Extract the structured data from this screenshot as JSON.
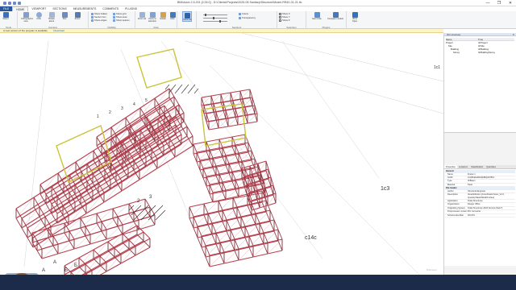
{
  "window": {
    "title": "BIMvision 2.6.201 [2.26.0] - D:\\Clients\\Projects\\2025-05 Sanitary\\Structure\\Model-RR42-01-21.ifc",
    "controls": [
      "—",
      "❐",
      "✕"
    ]
  },
  "tabs": [
    "FILE",
    "HOME",
    "VIEWPORT",
    "SECTIONS",
    "MEASUREMENTS",
    "COMMENTS",
    "PLUGINS"
  ],
  "active_tab": "HOME",
  "ribbon": {
    "groups": [
      "Tools",
      "Camera",
      "Visibility",
      "View",
      "Sections",
      "Selection",
      "Plugins"
    ],
    "buttons": [
      "Select",
      "Orthographic view",
      "Orbit",
      "Rotate about",
      "Pan",
      "Zoom",
      "Zoom all",
      "Zoom to selection",
      "Isolate",
      "Hide",
      "Show all",
      "Colors",
      "Transparency",
      "Nav Cube",
      "Compare models",
      "IFC4 Open"
    ],
    "small_items": [
      "Show hidden",
      "Section box",
      "Show edges",
      "Show grid",
      "Show axes",
      "Show spaces"
    ],
    "checks": [
      "Show X",
      "Show Y",
      "Show Z"
    ]
  },
  "notification": {
    "text": "A new version of the program is available.",
    "link": "Download"
  },
  "viewport": {
    "labels": [
      "1c3",
      "c14c",
      "1c1",
      "А",
      "Б",
      "А",
      "Б",
      "2",
      "3",
      "1",
      "2",
      "3",
      "4",
      "5"
    ],
    "watermark": "BIMvision"
  },
  "structure_panel": {
    "title": "IFC structure",
    "columns": [
      "Name",
      "Type"
    ],
    "rows": [
      [
        "Project",
        "IfcProject"
      ],
      [
        "Site",
        "IfcSite"
      ],
      [
        "Building",
        "IfcBuilding"
      ],
      [
        "Storey",
        "IfcBuildingStorey"
      ]
    ]
  },
  "properties_panel": {
    "tabs": [
      "Properties",
      "Locations",
      "Classification",
      "Quantities"
    ],
    "group_general": "General",
    "rows": [
      [
        "Name",
        "Frame 1"
      ],
      [
        "GUID",
        "2xQlNa0a3FH9jOBQ0AT5kV"
      ],
      [
        "Type",
        "IfcBeam"
      ],
      [
        "Material",
        "Steel"
      ]
    ],
    "group_header": "File header",
    "header_rows": [
      [
        "Author",
        "Structural Engineer"
      ],
      [
        "Description",
        "ViewDefinition [CoordinationView_V2.0, QuantityTakeOffAddOnView]"
      ],
      [
        "Application",
        "Tekla Structures"
      ],
      [
        "Organization",
        "Design Office"
      ],
      [
        "Originating System",
        "Tekla Structures 2023 Service Pack 5"
      ],
      [
        "Preprocessor version",
        "IFC Converter"
      ],
      [
        "Schema identifier",
        "IFC2X3"
      ]
    ]
  },
  "colors": {
    "accent": "#2b579a",
    "steel": "#b8404f",
    "highlight": "#c9c43a",
    "notify": "#fcf3c6",
    "taskbar": "#1c2b4a"
  }
}
